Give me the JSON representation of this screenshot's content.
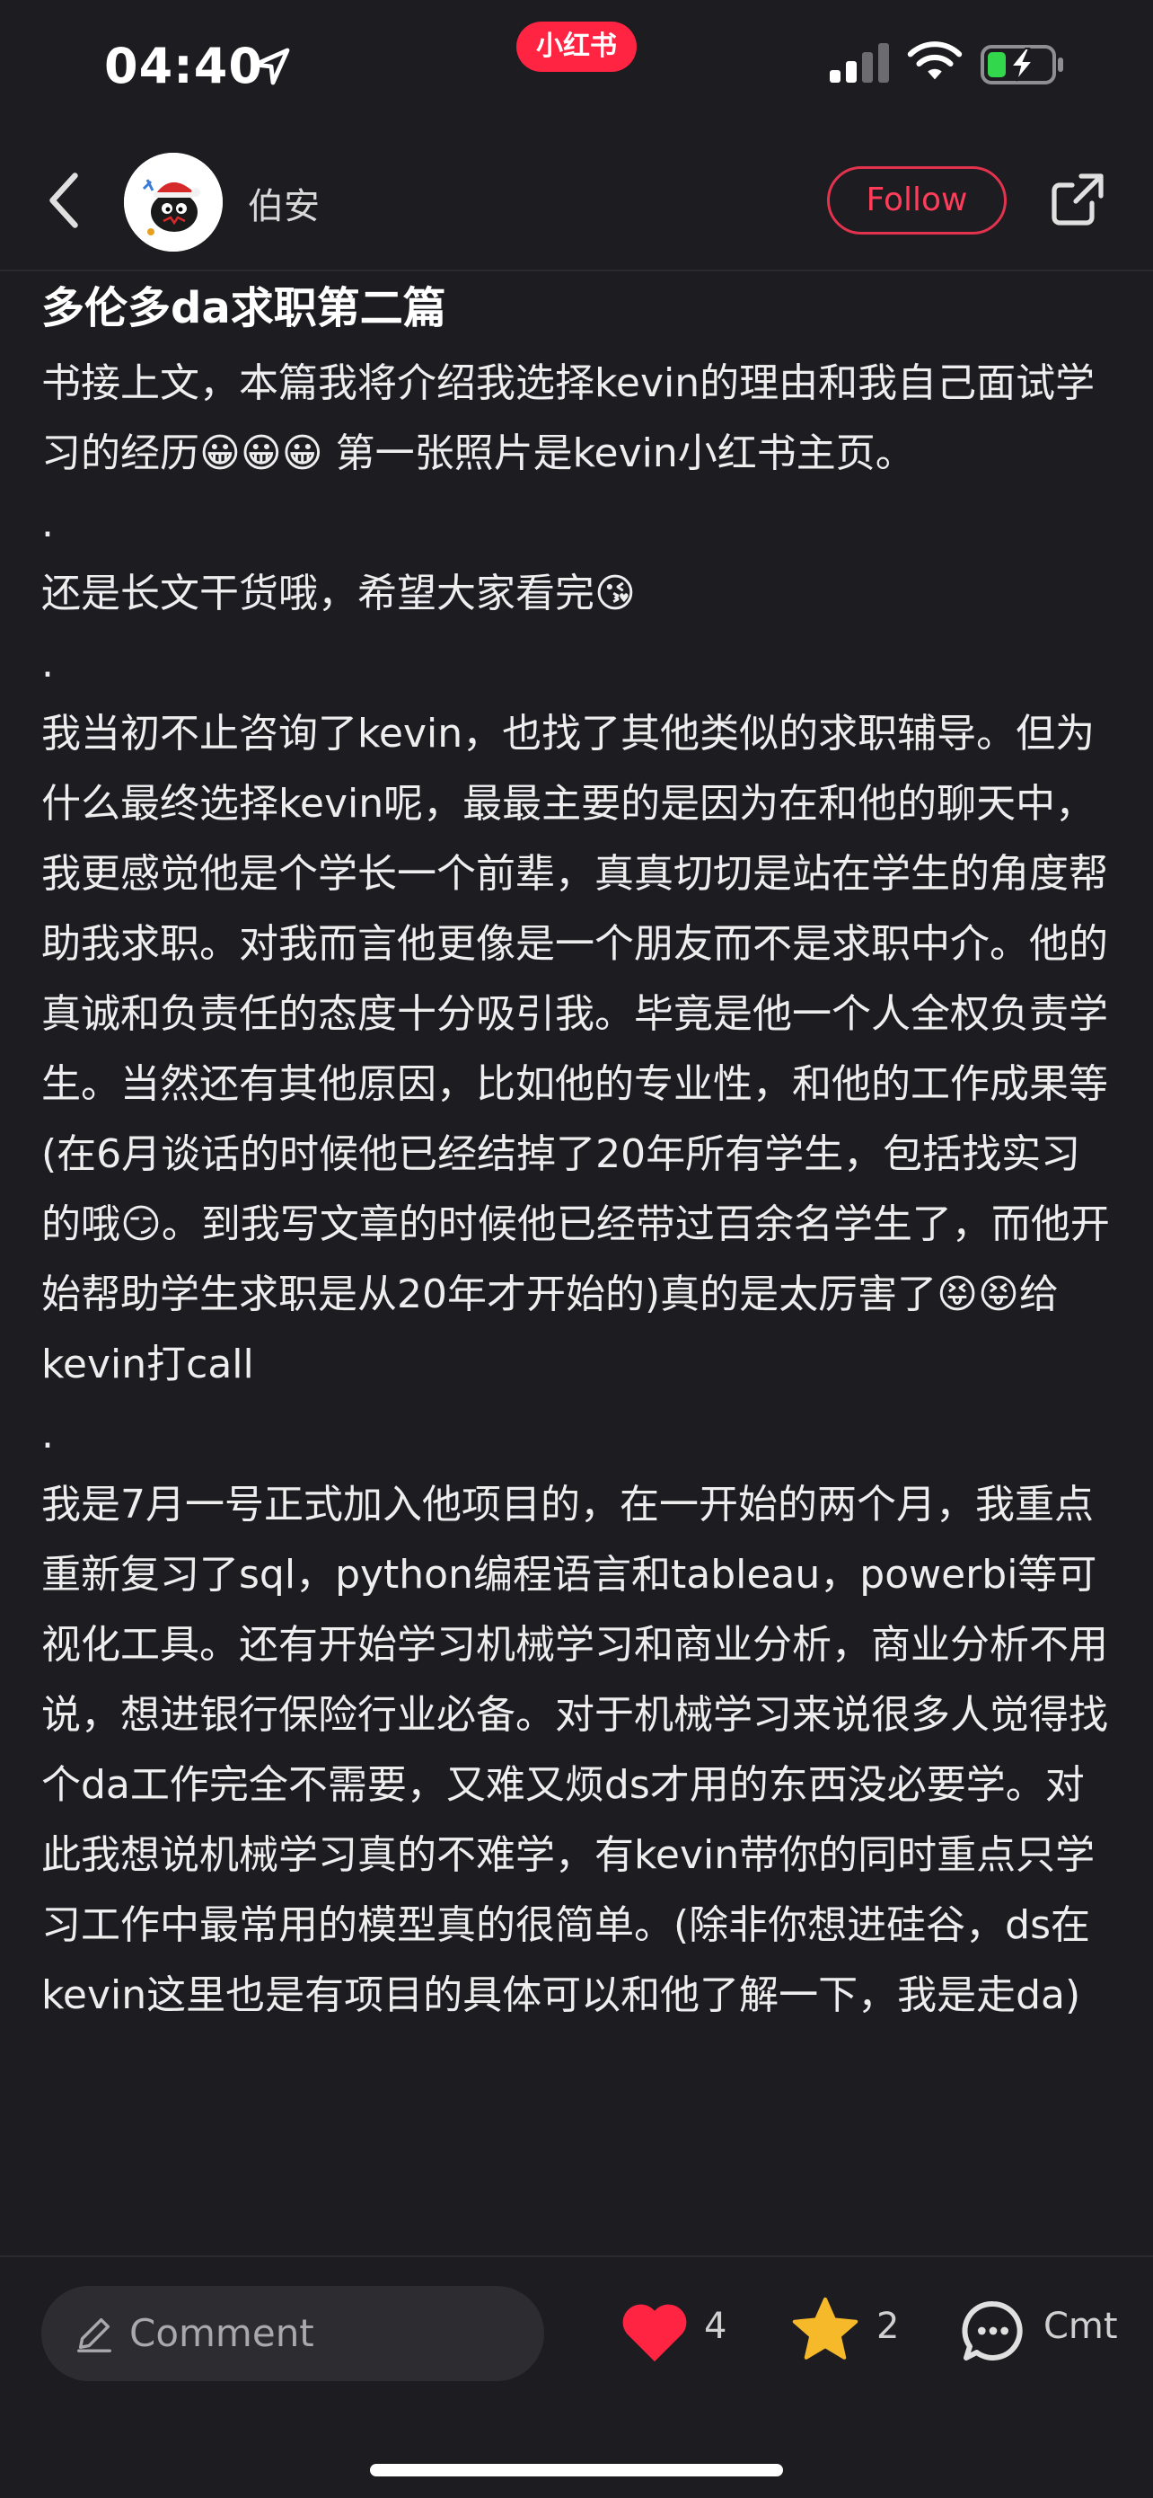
{
  "status_bar": {
    "time": "04:40",
    "app_badge": "小红书",
    "icons": [
      "location-arrow-icon",
      "signal-icon",
      "wifi-icon",
      "battery-charging-icon"
    ]
  },
  "header": {
    "author_name": "伯安",
    "follow_label": "Follow",
    "icons": [
      "back-chevron-icon",
      "share-icon"
    ]
  },
  "post": {
    "title": "多伦多da求职第二篇",
    "paragraphs": [
      "书接上文，本篇我将介绍我选择kevin的理由和我自己面试学习的经历😀😀😀 第一张照片是kevin小红书主页。",
      ".",
      "还是长文干货哦，希望大家看完😘",
      ".",
      "我当初不止咨询了kevin，也找了其他类似的求职辅导。但为什么最终选择kevin呢，最最主要的是因为在和他的聊天中，我更感觉他是个学长一个前辈，真真切切是站在学生的角度帮助我求职。对我而言他更像是一个朋友而不是求职中介。他的真诚和负责任的态度十分吸引我。毕竟是他一个人全权负责学生。当然还有其他原因，比如他的专业性，和他的工作成果等",
      "(在6月谈话的时候他已经结掉了20年所有学生，包括找实习的哦😏。到我写文章的时候他已经带过百余名学生了，而他开始帮助学生求职是从20年才开始的)真的是太厉害了😝😝给kevin打call",
      ".",
      "我是7月一号正式加入他项目的，在一开始的两个月，我重点重新复习了sql，python编程语言和tableau，powerbi等可视化工具。还有开始学习机械学习和商业分析，商业分析不用说，想进银行保险行业必备。对于机械学习来说很多人觉得找个da工作完全不需要，又难又烦ds才用的东西没必要学。对此我想说机械学习真的不难学，有kevin带你的同时重点只学习工作中最常用的模型真的很简单。(除非你想进硅谷，ds在kevin这里也是有项目的具体可以和他了解一下，我是走da)"
    ]
  },
  "bottom_bar": {
    "comment_placeholder": "Comment",
    "like_count": "4",
    "collect_count": "2",
    "comment_label": "Cmt",
    "icons": [
      "pencil-icon",
      "heart-icon",
      "star-icon",
      "comment-bubble-icon"
    ],
    "accent_colors": {
      "like": "#ff2442",
      "star": "#f5b92a",
      "follow": "#ff3d5a"
    }
  }
}
